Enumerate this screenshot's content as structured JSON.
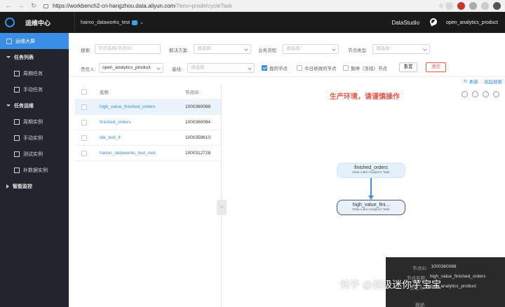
{
  "browser": {
    "url_main": "https://workbench2-cn-hangzhou.data.aliyun.com",
    "url_rest": "/?env=prod#/cycleTask"
  },
  "header": {
    "app_title": "运维中心",
    "workspace": "haimo_dataworks_test",
    "studio": "DataStudio",
    "user": "open_analytics_product"
  },
  "sidebar": {
    "items": [
      {
        "label": "运维大屏",
        "type": "active"
      },
      {
        "label": "任务列表",
        "type": "group"
      },
      {
        "label": "周期任务",
        "type": "sub"
      },
      {
        "label": "手动任务",
        "type": "sub"
      },
      {
        "label": "任务运维",
        "type": "group"
      },
      {
        "label": "周期实例",
        "type": "sub"
      },
      {
        "label": "手动实例",
        "type": "sub"
      },
      {
        "label": "测试实例",
        "type": "sub"
      },
      {
        "label": "补数据实例",
        "type": "sub"
      },
      {
        "label": "智能监控",
        "type": "group"
      }
    ]
  },
  "filters": {
    "search_label": "搜索:",
    "search_placeholder": "节点名称/节点ID",
    "solution_label": "解决方案:",
    "solution_placeholder": "请选择",
    "flow_label": "业务流程:",
    "flow_placeholder": "请选择",
    "nodetype_label": "节点类型:",
    "nodetype_placeholder": "请选择",
    "owner_label": "责任人:",
    "owner_value": "open_analytics_product",
    "baseline_label": "基线:",
    "baseline_placeholder": "请选择",
    "my_nodes": "我的节点",
    "modified_today": "今日修改的节点",
    "paused": "暂停（冻结）节点",
    "reset_btn": "重置",
    "clear_btn": "清空",
    "refresh_link": "刷新",
    "collapse_link": "收起搜索"
  },
  "table": {
    "headers": {
      "name": "名称",
      "id": "节点ID"
    },
    "rows": [
      {
        "name": "high_value_finished_orders",
        "id": "1000360088"
      },
      {
        "name": "finished_orders",
        "id": "1000360084"
      },
      {
        "name": "dla_test_4",
        "id": "1000359610"
      },
      {
        "name": "haimo_dataworks_test_root",
        "id": "1000312728"
      }
    ]
  },
  "canvas": {
    "warning": "生产环境，请谨慎操作",
    "node_top": {
      "name": "finished_orders",
      "type": "Data Lake Analytics Task"
    },
    "node_bottom": {
      "name": "high_value_fini...",
      "type": "Data Lake Analytics Task"
    }
  },
  "info": {
    "id_label": "节点ID:",
    "id_value": "1000360088",
    "name_label": "节点名称:",
    "name_value": "high_value_finished_orders",
    "owner_label": "责任人:",
    "owner_value": "open_analytics_product",
    "desc_label": "描述:"
  },
  "watermark": "知乎 @超级迷你芋宝宝"
}
